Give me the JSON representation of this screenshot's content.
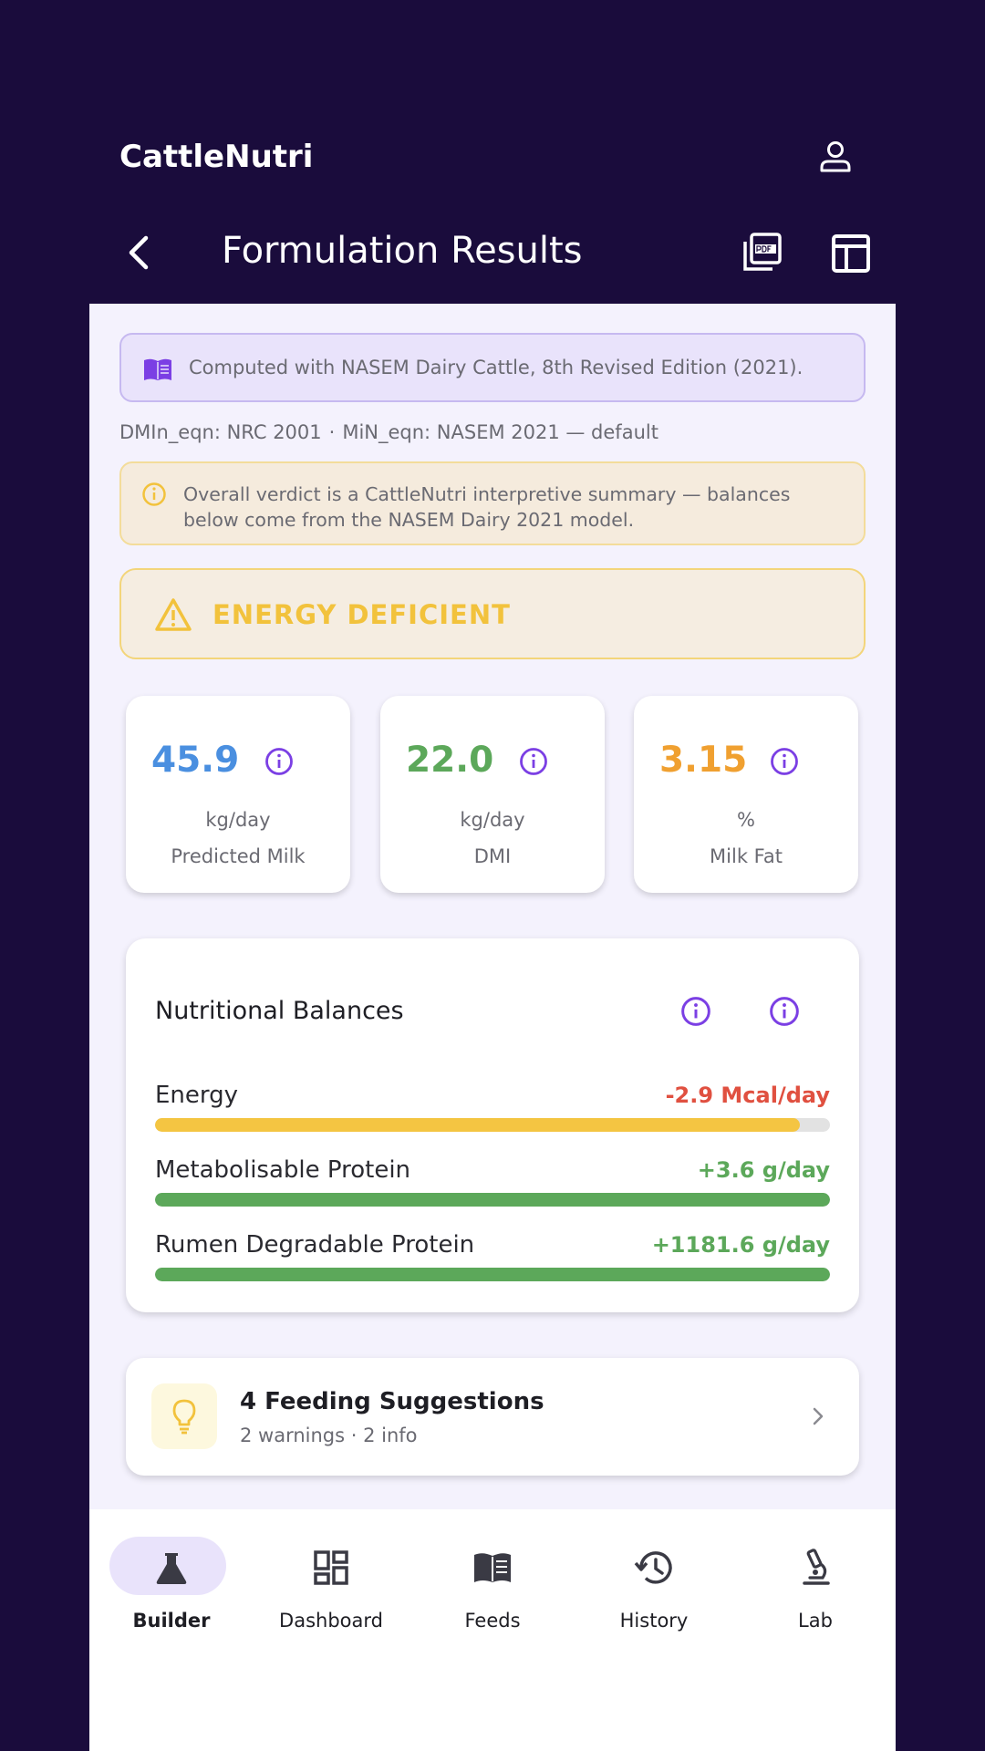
{
  "app": {
    "brand": "CattleNutri",
    "screen_title": "Formulation Results"
  },
  "source": {
    "text": "Computed with NASEM Dairy Cattle, 8th Revised Edition (2021).",
    "icon": "book-icon"
  },
  "equations": {
    "dmi": "DMIn_eqn: NRC 2001",
    "separator": "·",
    "mi": "MiN_eqn: NASEM 2021 — default"
  },
  "disclaimer": {
    "text": "Overall verdict is a CattleNutri interpretive summary — balances below come from the NASEM Dairy 2021 model."
  },
  "verdict": {
    "label": "ENERGY DEFICIENT",
    "color": "#f2c23c"
  },
  "metrics": [
    {
      "value": "45.9",
      "unit": "kg/day",
      "label": "Predicted Milk",
      "color": "#4a8fe0"
    },
    {
      "value": "22.0",
      "unit": "kg/day",
      "label": "DMI",
      "color": "#5ca85a"
    },
    {
      "value": "3.15",
      "unit": "%",
      "label": "Milk Fat",
      "color": "#f0a030"
    }
  ],
  "balances": {
    "title": "Nutritional Balances",
    "rows": [
      {
        "label": "Energy",
        "value": "-2.9 Mcal/day",
        "fill_fraction": 0.955,
        "value_color": "#e05040",
        "bar_color": "#f4c542"
      },
      {
        "label": "Metabolisable Protein",
        "value": "+3.6 g/day",
        "fill_fraction": 1.0,
        "value_color": "#5ca85a",
        "bar_color": "#5ca85a"
      },
      {
        "label": "Rumen Degradable Protein",
        "value": "+1181.6 g/day",
        "fill_fraction": 1.0,
        "value_color": "#5ca85a",
        "bar_color": "#5ca85a"
      }
    ]
  },
  "suggestions": {
    "title": "4 Feeding Suggestions",
    "subtitle": "2 warnings · 2 info"
  },
  "nav": [
    {
      "label": "Builder",
      "icon": "flask-icon",
      "active": true
    },
    {
      "label": "Dashboard",
      "icon": "dashboard-icon",
      "active": false
    },
    {
      "label": "Feeds",
      "icon": "book-icon",
      "active": false
    },
    {
      "label": "History",
      "icon": "history-icon",
      "active": false
    },
    {
      "label": "Lab",
      "icon": "microscope-icon",
      "active": false
    }
  ],
  "colors": {
    "header_bg": "#1a0c3c",
    "accent": "#7b3fe4",
    "page_bg": "#f4f2fd"
  }
}
